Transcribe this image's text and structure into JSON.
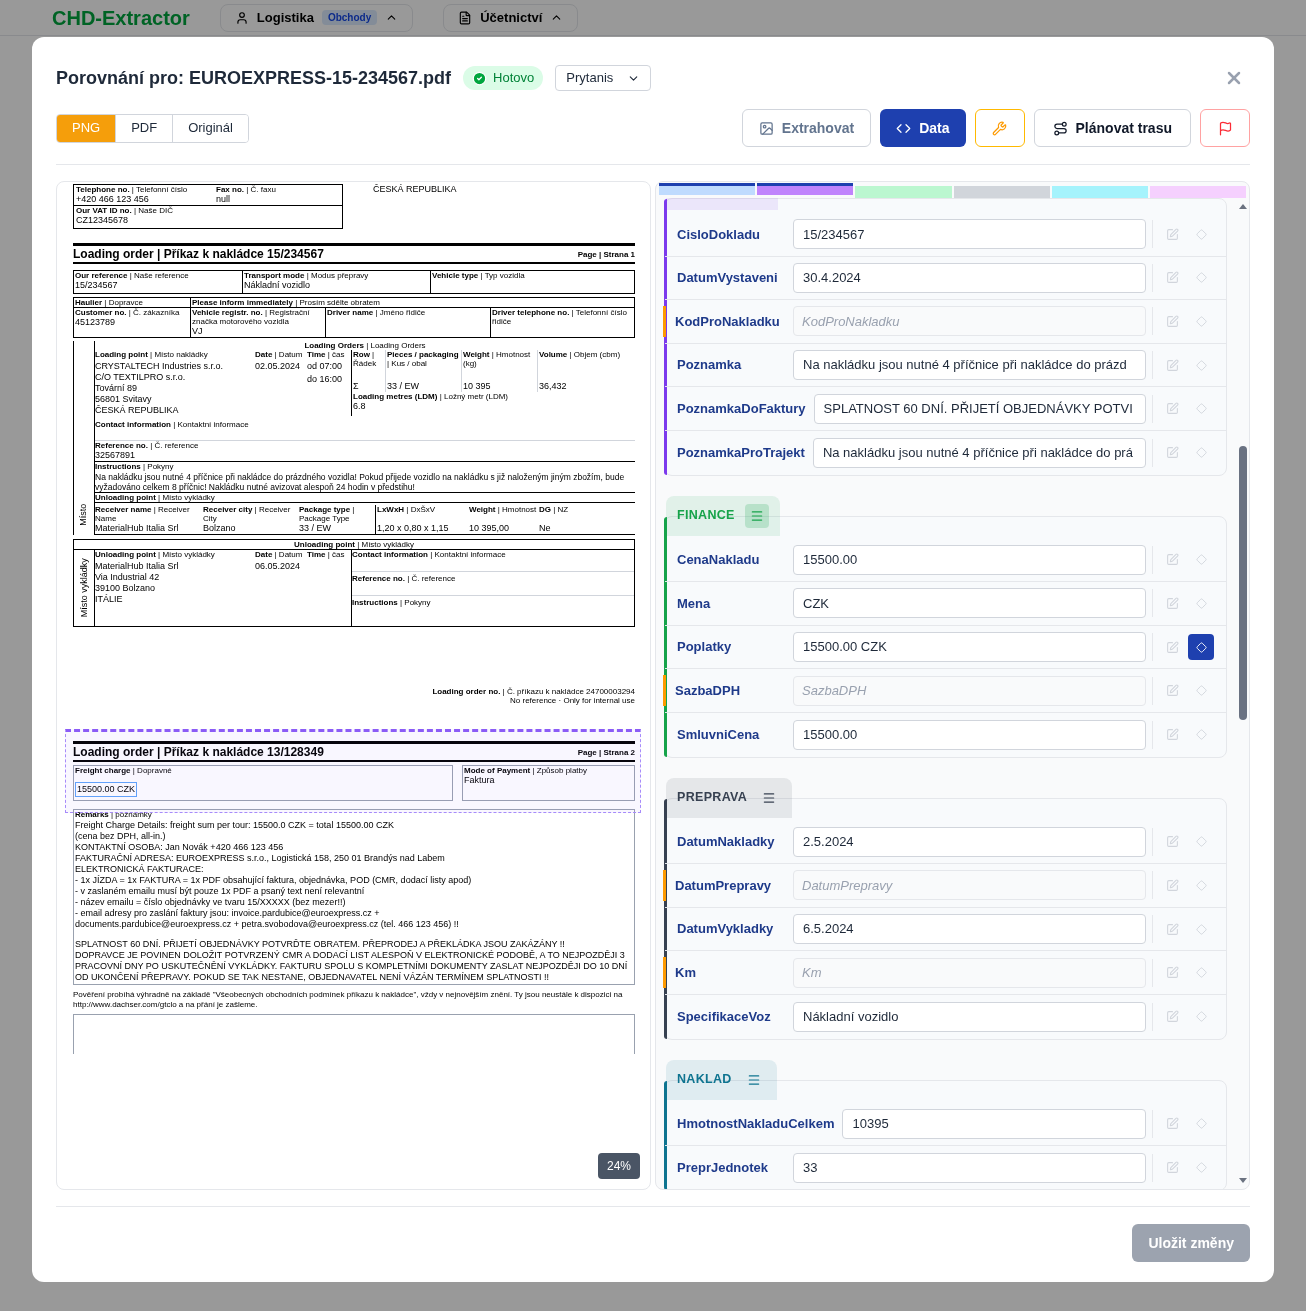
{
  "background": {
    "app_title": "CHD-Extractor",
    "nav": [
      {
        "label": "Logistika",
        "badge": "Obchody"
      },
      {
        "label": "Účetnictví"
      }
    ]
  },
  "dialog": {
    "title": "Porovnání pro: EUROEXPRESS-15-234567.pdf",
    "status": "Hotovo",
    "model": "Prytanis",
    "view_tabs": [
      {
        "label": "PNG",
        "selected": true
      },
      {
        "label": "PDF",
        "selected": false
      },
      {
        "label": "Originál",
        "selected": false
      }
    ],
    "actions": [
      {
        "kind": "extract",
        "label": "Extrahovat"
      },
      {
        "kind": "data",
        "label": "Data"
      },
      {
        "kind": "tool"
      },
      {
        "kind": "route",
        "label": "Plánovat trasu"
      },
      {
        "kind": "flag"
      }
    ],
    "save_button": {
      "label": "Uložit změny",
      "disabled": true
    }
  },
  "document": {
    "zoom": "24%",
    "page1": {
      "contact": [
        {
          "label": "**Telephone no.** | Telefonní číslo",
          "value": "+420 466 123 456"
        },
        {
          "label": "**Fax no.** | Č. faxu",
          "value": "null"
        },
        {
          "label": "**Our VAT ID no.** | Naše DIČ",
          "value": "CZ12345678"
        }
      ],
      "country": "ČESKÁ REPUBLIKA",
      "title": "Loading order | Příkaz k nakládce 15/234567",
      "page": "Page | Strana 1",
      "rows": [
        [
          {
            "label": "**Our reference** | Naše reference",
            "value": "15/234567"
          },
          {
            "label": "**Transport mode** | Modus přepravy",
            "value": "Nákladní vozidlo"
          },
          {
            "label": "**Vehicle type** | Typ vozidla"
          }
        ],
        [
          {
            "label": "**Haulier** | Dopravce"
          },
          {
            "label": "**Please inform immediately** | Prosím sdělte obratem"
          }
        ],
        [
          {
            "label": "**Customer no.** | Č. zákazníka",
            "value": "45123789"
          },
          {
            "label": "**Vehicle registr. no.** | Registrační značka motorového vozidla",
            "value": "VJ"
          },
          {
            "label": "**Driver name** | Jméno řidiče"
          },
          {
            "label": "**Driver telephone no.** | Telefonní číslo řidiče"
          }
        ]
      ],
      "loading": {
        "heading": "**Loading Orders** | Loading Orders",
        "side": "Místo",
        "point_label": "**Loading point** | Místo nakládky",
        "address": [
          "CRYSTALTECH Industries s.r.o.",
          "C/O TEXTILPRO s.r.o.",
          "Tovární 89",
          "56801 Svitavy",
          "ČESKÁ REPUBLIKA"
        ],
        "date_label": "**Date** | Datum",
        "date": "02.05.2024",
        "time_label": "**Time** | čas",
        "times": [
          "od 07:00",
          "do 16:00"
        ],
        "columns": [
          {
            "label": "**Row** | Řádek",
            "value": "Σ"
          },
          {
            "label": "**Pieces / packaging** | Kus / obal",
            "value": "33 / EW"
          },
          {
            "label": "**Weight** | Hmotnost (kg)",
            "value": "10 395"
          },
          {
            "label": "**Volume** | Objem (cbm)",
            "value": "36,432"
          }
        ],
        "ldm_label": "**Loading metres (LDM)** | Ložný metr (LDM)",
        "ldm": "6.8",
        "contact_label": "**Contact information** | Kontaktní informace",
        "reference_label": "**Reference no.** | Č. reference",
        "reference": "32567891",
        "instructions_label": "**Instructions** | Pokyny",
        "instructions": "Na nakládku jsou nutné 4 příčnice při nakládce do prázdného vozidla! Pokud přijede vozidlo na nakládku s již naloženým jiným zbožím, bude vyžadováno celkem 8 příčnic! Nakládku nutné avizovat alespoň 24 hodin v předstihu!",
        "unloading_label": "**Unloading point** | Místo vykládky",
        "table_columns": [
          "**Receiver name** | Receiver Name",
          "**Receiver city** | Receiver City",
          "**Package type** | Package Type",
          "**LxWxH** | DxŠxV",
          "**Weight** | Hmotnost",
          "**DG** | NZ"
        ],
        "table_row": [
          "MaterialHub Italia Srl",
          "Bolzano",
          "33 / EW",
          "1,20 x 0,80 x 1,15",
          "10 395,00",
          "Ne"
        ]
      },
      "unloading": {
        "heading": "**Unloading point** | Místo vykládky",
        "side": "Místo vykládky",
        "point_label": "**Unloading point** | Místo vykládky",
        "address": [
          "MaterialHub Italia Srl",
          "Via Industrial 42",
          "39100 Bolzano",
          "ITÁLIE"
        ],
        "date_label": "**Date** | Datum",
        "date": "06.05.2024",
        "time_label": "**Time** | čas",
        "contact_label": "**Contact information** | Kontaktní informace",
        "reference_label": "**Reference no.** | Č. reference",
        "instructions_label": "**Instructions** | Pokyny"
      },
      "footer": [
        "**Loading order no.** | Č. příkazu k nakládce 24700003294",
        "No reference · Only for internal use"
      ]
    },
    "page2": {
      "title": "Loading order | Příkaz k nakládce 13/128349",
      "page": "Page | Strana 2",
      "freight_label": "**Freight charge** | Dopravné",
      "freight": "15500.00 CZK",
      "payment_label": "**Mode of Payment** | Způsob platby",
      "payment": "Faktura",
      "remarks_label": "**Remarks** | poznámky",
      "remarks": [
        [
          "Freight Charge Details: freight sum per tour: 15500.0 CZK = total 15500.00 CZK",
          " (cena bez DPH, all-in.)",
          "KONTAKTNÍ OSOBA: Jan Novák +420 466 123 456",
          "FAKTURAČNÍ ADRESA: EUROEXPRESS s.r.o., Logistická 158, 250 01 Brandýs nad Labem",
          "ELEKTRONICKÁ FAKTURACE:",
          "- 1x JÍZDA = 1x FAKTURA = 1x PDF obsahující faktura, objednávka, POD (CMR, dodací listy apod)",
          "- v zaslaném emailu musí být pouze 1x PDF a psaný text není relevantní",
          "- název emailu = číslo objednávky ve tvaru 15/XXXXX (bez mezer!!)",
          "- email adresy pro zaslání faktury jsou: invoice.pardubice@euroexpress.cz +",
          "documents.pardubice@euroexpress.cz + petra.svobodova@euroexpress.cz (tel. 466 123 456) !!"
        ],
        [
          "SPLATNOST 60 DNÍ.  PŘIJETÍ OBJEDNÁVKY POTVRĎTE OBRATEM. PŘEPRODEJ A PŘEKLÁDKA JSOU ZAKÁZÁNY !!",
          "DOPRAVCE JE POVINEN DOLOŽIT POTVRZENÝ CMR A DODACÍ LIST ALESPOŇ V ELEKTRONICKÉ PODOBĚ, A TO NEJPOZDĚJI 3 PRACOVNÍ DNY PO USKUTEČNĚNÍ VYKLÁDKY. FAKTURU SPOLU S KOMPLETNÍMI DOKUMENTY ZASLAT NEJPOZDĚJI DO 10 DNÍ OD UKONČENÍ PŘEPRAVY. POKUD SE TAK NESTANE, OBJEDNAVATEL NENÍ VÁZÁN TERMÍNEM SPLATNOSTI !!"
        ]
      ],
      "terms": "Pověření probíhá výhradně na základě \"Všeobecných obchodních podmínek příkazu k nakládce\", vždy v nejnovějším znění. Ty jsou neustále k dispozici na http://www.dachser.com/gtclo a na přání je zašleme."
    }
  },
  "section_strip": [
    {
      "color": "#bfdbfe",
      "selected": true
    },
    {
      "color": "#c084fc",
      "selected": true
    },
    {
      "color": "#bbf7d0",
      "selected": false
    },
    {
      "color": "#d1d5db",
      "selected": false
    },
    {
      "color": "#a5f3fc",
      "selected": false
    },
    {
      "color": "#f5d0fe",
      "selected": false
    }
  ],
  "sections": [
    {
      "color": "#7c3aed",
      "fields": [
        {
          "label": "CisloDokladu",
          "value": "15/234567",
          "missing": false,
          "located": false
        },
        {
          "label": "DatumVystaveni",
          "value": "30.4.2024",
          "missing": false,
          "located": false
        },
        {
          "label": "KodProNakladku",
          "placeholder": "KodProNakladku",
          "missing": true,
          "located": false
        },
        {
          "label": "Poznamka",
          "value": "Na nakládku jsou nutné 4 příčnice při nakládce do prázd",
          "missing": false,
          "located": false
        },
        {
          "label": "PoznamkaDoFaktury",
          "value": "SPLATNOST 60 DNÍ. PŘIJETÍ OBJEDNÁVKY POTVI",
          "missing": false,
          "located": false
        },
        {
          "label": "PoznamkaProTrajekt",
          "value": "Na nakládku jsou nutné 4 příčnice při nakládce do prá",
          "missing": false,
          "located": false
        }
      ]
    },
    {
      "title": "FINANCE",
      "color": "#16a34a",
      "menu_active": true,
      "fields": [
        {
          "label": "CenaNakladu",
          "value": "15500.00",
          "missing": false,
          "located": false
        },
        {
          "label": "Mena",
          "value": "CZK",
          "missing": false,
          "located": false
        },
        {
          "label": "Poplatky",
          "value": "15500.00 CZK",
          "missing": false,
          "located": true
        },
        {
          "label": "SazbaDPH",
          "placeholder": "SazbaDPH",
          "missing": true,
          "located": false
        },
        {
          "label": "SmluvniCena",
          "value": "15500.00",
          "missing": false,
          "located": false
        }
      ]
    },
    {
      "title": "PREPRAVA",
      "color": "#374151",
      "menu_active": false,
      "fields": [
        {
          "label": "DatumNakladky",
          "value": "2.5.2024",
          "missing": false,
          "located": false
        },
        {
          "label": "DatumPrepravy",
          "placeholder": "DatumPrepravy",
          "missing": true,
          "located": false
        },
        {
          "label": "DatumVykladky",
          "value": "6.5.2024",
          "missing": false,
          "located": false
        },
        {
          "label": "Km",
          "placeholder": "Km",
          "missing": true,
          "located": false
        },
        {
          "label": "SpecifikaceVoz",
          "value": "Nákladní vozidlo",
          "missing": false,
          "located": false
        }
      ]
    },
    {
      "title": "NAKLAD",
      "color": "#0e7490",
      "menu_active": false,
      "fields": [
        {
          "label": "HmotnostNakladuCelkem",
          "value": "10395",
          "missing": false,
          "located": false
        },
        {
          "label": "PreprJednotek",
          "value": "33",
          "missing": false,
          "located": false
        }
      ]
    }
  ]
}
